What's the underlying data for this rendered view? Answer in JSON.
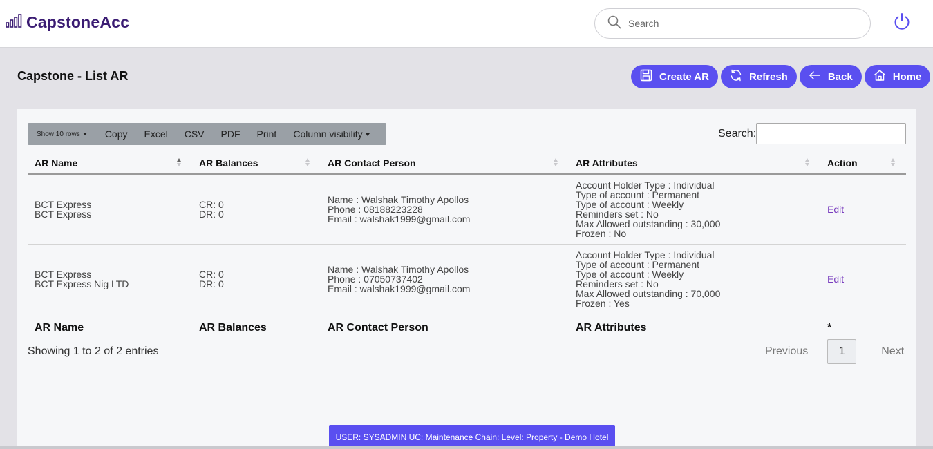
{
  "brand": {
    "name": "CapstoneAcc"
  },
  "topbar": {
    "search_placeholder": "Search"
  },
  "page": {
    "title": "Capstone - List AR"
  },
  "actions": [
    {
      "label": "Create AR",
      "icon": "save-icon"
    },
    {
      "label": "Refresh",
      "icon": "refresh-icon"
    },
    {
      "label": "Back",
      "icon": "arrow-left-icon"
    },
    {
      "label": "Home",
      "icon": "home-icon"
    }
  ],
  "table_tools": {
    "show_rows": "Show 10 rows",
    "copy": "Copy",
    "excel": "Excel",
    "csv": "CSV",
    "pdf": "PDF",
    "print": "Print",
    "column_visibility": "Column visibility",
    "search_label": "Search:",
    "search_value": ""
  },
  "table": {
    "headers": [
      "AR Name",
      "AR Balances",
      "AR Contact Person",
      "AR Attributes",
      "Action"
    ],
    "footers": [
      "AR Name",
      "AR Balances",
      "AR Contact Person",
      "AR Attributes",
      "*"
    ],
    "rows": [
      {
        "name": [
          "BCT Express",
          "BCT Express"
        ],
        "balances": [
          "CR: 0",
          "DR: 0"
        ],
        "contact": [
          "Name : Walshak Timothy Apollos",
          "Phone : 08188223228",
          "Email : walshak1999@gmail.com"
        ],
        "attributes": [
          "Account Holder Type : Individual",
          "Type of account : Permanent",
          "Type of account : Weekly",
          "Reminders set : No",
          "Max Allowed outstanding : 30,000",
          "Frozen : No"
        ],
        "action": "Edit"
      },
      {
        "name": [
          "BCT Express",
          "BCT Express Nig LTD"
        ],
        "balances": [
          "CR: 0",
          "DR: 0"
        ],
        "contact": [
          "Name : Walshak Timothy Apollos",
          "Phone : 07050737402",
          "Email : walshak1999@gmail.com"
        ],
        "attributes": [
          "Account Holder Type : Individual",
          "Type of account : Permanent",
          "Type of account : Weekly",
          "Reminders set : No",
          "Max Allowed outstanding : 70,000",
          "Frozen : Yes"
        ],
        "action": "Edit"
      }
    ]
  },
  "info": "Showing 1 to 2 of 2 entries",
  "pagination": {
    "previous": "Previous",
    "current": "1",
    "next": "Next"
  },
  "statusbar": "USER: SYSADMIN UC: Maintenance Chain: Level: Property - Demo Hotel",
  "colors": {
    "accent": "#5a4ff0",
    "brand": "#3b1c73",
    "link": "#7b3fbf"
  }
}
